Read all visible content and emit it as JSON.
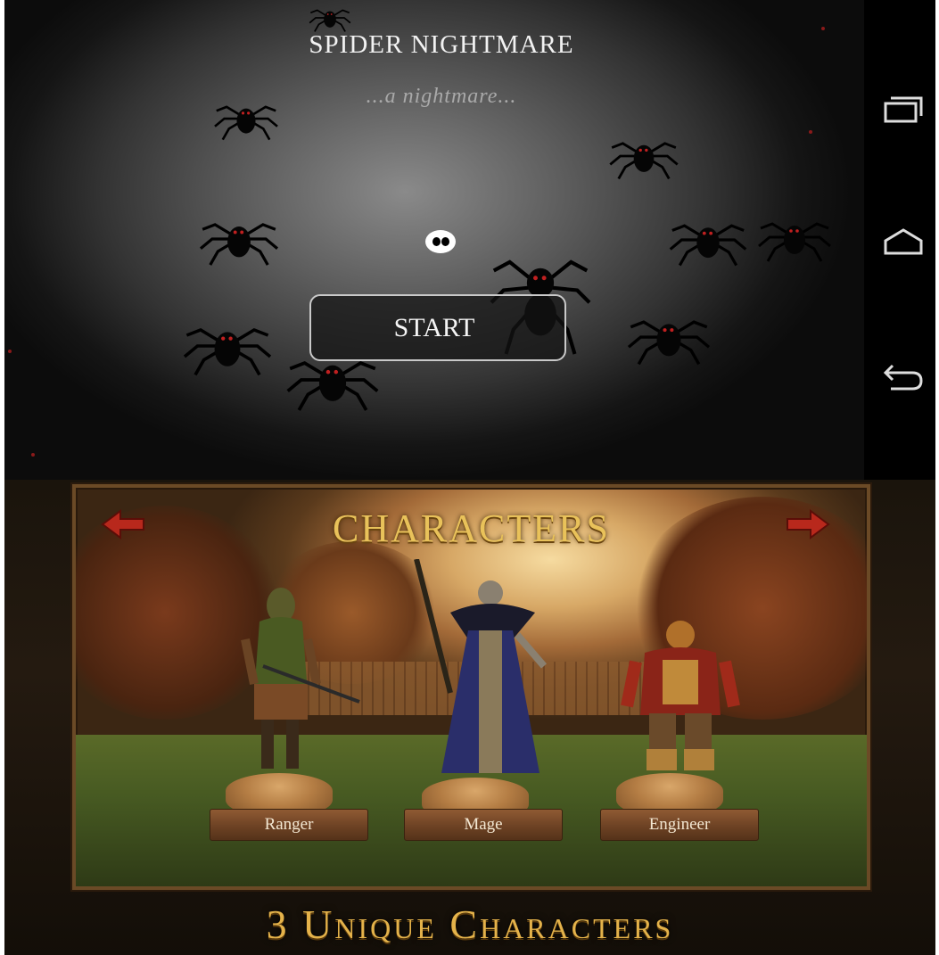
{
  "top_screen": {
    "title": "SPIDER NIGHTMARE",
    "subtitle": "...a nightmare...",
    "start_label": "START",
    "nav_buttons": [
      "recent-apps-icon",
      "home-icon",
      "back-icon"
    ]
  },
  "bottom_screen": {
    "heading": "CHARACTERS",
    "characters": [
      "Ranger",
      "Mage",
      "Engineer"
    ],
    "tagline": "3 Unique Characters",
    "arrows": [
      "arrow-left-icon",
      "arrow-right-icon"
    ]
  },
  "colors": {
    "nav_bar": "#000000",
    "gold_text": "#e9c25a",
    "plank_wood": "#6d4224"
  }
}
